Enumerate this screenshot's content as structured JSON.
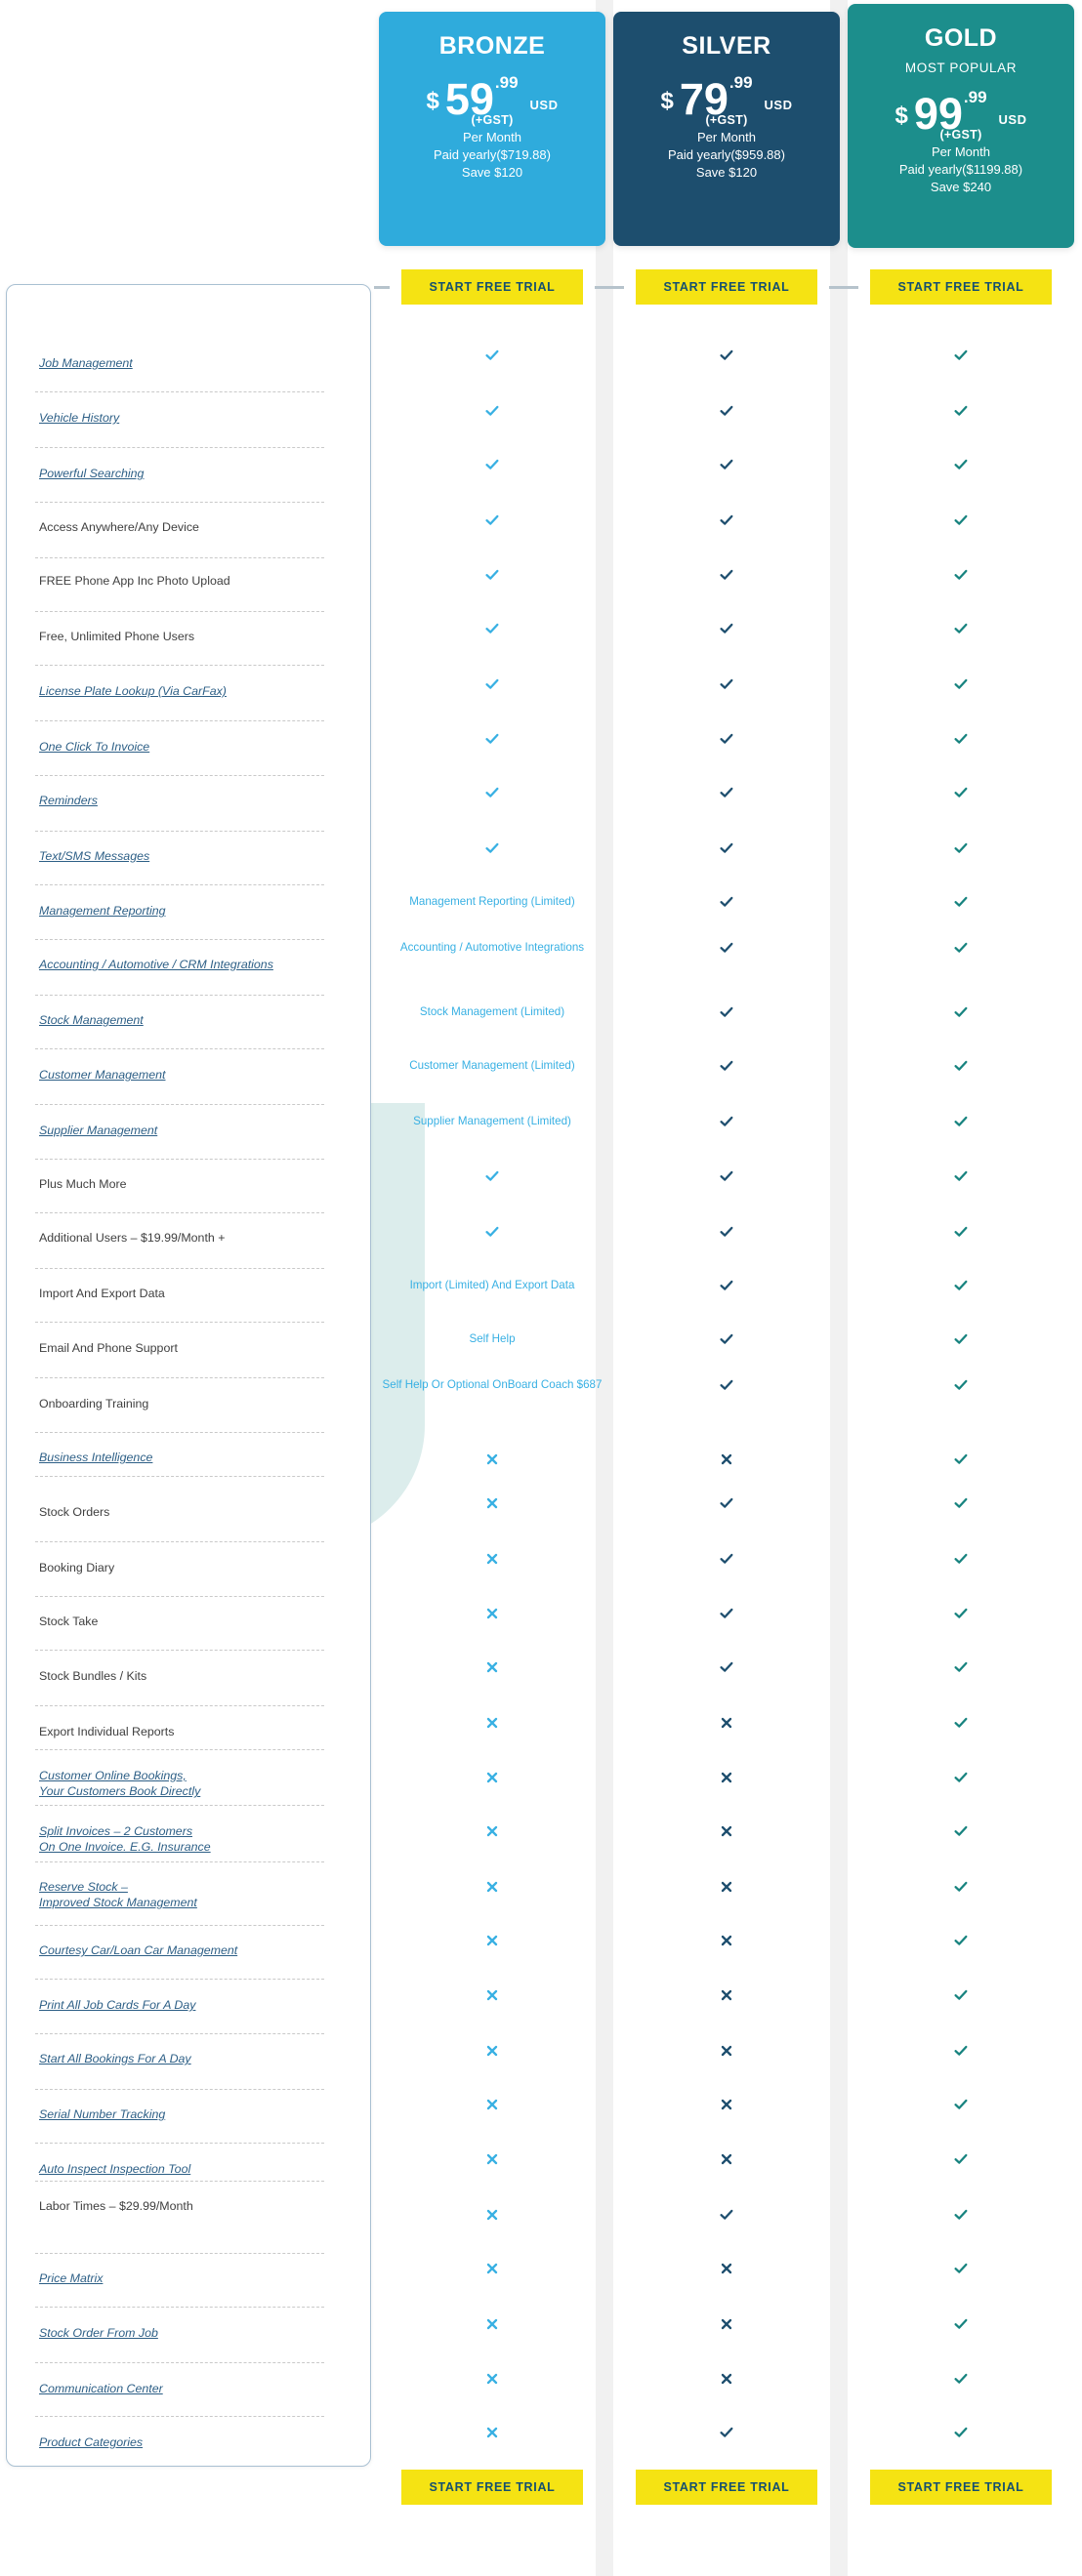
{
  "plans": [
    {
      "key": "bronze",
      "name": "BRONZE",
      "tagline": "",
      "currency": "$",
      "price": "59",
      "cents": ".99",
      "usd": "USD",
      "gst": "(+GST)",
      "period": "Per Month",
      "paid_yearly": "Paid yearly($719.88)",
      "save": "Save $120",
      "cta": "START FREE TRIAL",
      "color": "#2fabdc",
      "mark_color": "#38b0e3"
    },
    {
      "key": "silver",
      "name": "SILVER",
      "tagline": "",
      "currency": "$",
      "price": "79",
      "cents": ".99",
      "usd": "USD",
      "gst": "(+GST)",
      "period": "Per Month",
      "paid_yearly": "Paid yearly($959.88)",
      "save": "Save $120",
      "cta": "START FREE TRIAL",
      "color": "#1d4e6e",
      "mark_color": "#1d4e6e"
    },
    {
      "key": "gold",
      "name": "GOLD",
      "tagline": "MOST POPULAR",
      "currency": "$",
      "price": "99",
      "cents": ".99",
      "usd": "USD",
      "gst": "(+GST)",
      "period": "Per Month",
      "paid_yearly": "Paid yearly($1199.88)",
      "save": "Save $240",
      "cta": "START FREE TRIAL",
      "color": "#1c8e8c",
      "mark_color": "#17837f"
    }
  ],
  "colors": {
    "accent_yellow": "#f5e313",
    "cta_text": "#15506f",
    "link_blue": "#2d5f86",
    "body_text": "#3f3f3f",
    "panel_border": "#a9c0d2",
    "gap_grey": "#f1f1f1",
    "watermark": "#dcedec"
  },
  "features": [
    {
      "label": "Job Management",
      "link": true,
      "bronze": "check",
      "silver": "check",
      "gold": "check"
    },
    {
      "label": "Vehicle History",
      "link": true,
      "bronze": "check",
      "silver": "check",
      "gold": "check"
    },
    {
      "label": "Powerful Searching",
      "link": true,
      "bronze": "check",
      "silver": "check",
      "gold": "check"
    },
    {
      "label": "Access Anywhere/Any Device",
      "link": false,
      "bronze": "check",
      "silver": "check",
      "gold": "check"
    },
    {
      "label": "FREE Phone App Inc Photo Upload",
      "link": false,
      "bronze": "check",
      "silver": "check",
      "gold": "check"
    },
    {
      "label": "Free, Unlimited Phone Users",
      "link": false,
      "bronze": "check",
      "silver": "check",
      "gold": "check"
    },
    {
      "label": "License Plate Lookup (Via CarFax)",
      "link": true,
      "bronze": "check",
      "silver": "check",
      "gold": "check"
    },
    {
      "label": "One Click To Invoice",
      "link": true,
      "bronze": "check",
      "silver": "check",
      "gold": "check"
    },
    {
      "label": "Reminders",
      "link": true,
      "bronze": "check",
      "silver": "check",
      "gold": "check"
    },
    {
      "label": "Text/SMS Messages",
      "link": true,
      "bronze": "check",
      "silver": "check",
      "gold": "check"
    },
    {
      "label": "Management Reporting",
      "link": true,
      "bronze": "Management Reporting (Limited)",
      "silver": "check",
      "gold": "check"
    },
    {
      "label": "Accounting / Automotive / CRM Integrations",
      "link": true,
      "bronze": "Accounting / Automotive Integrations",
      "silver": "check",
      "gold": "check"
    },
    {
      "label": "Stock Management",
      "link": true,
      "bronze": "Stock Management (Limited)",
      "silver": "check",
      "gold": "check"
    },
    {
      "label": "Customer Management",
      "link": true,
      "bronze": "Customer Management (Limited)",
      "silver": "check",
      "gold": "check"
    },
    {
      "label": "Supplier Management",
      "link": true,
      "bronze": "Supplier Management (Limited)",
      "silver": "check",
      "gold": "check"
    },
    {
      "label": "Plus Much More",
      "link": false,
      "bronze": "check",
      "silver": "check",
      "gold": "check"
    },
    {
      "label": "Additional Users – $19.99/Month +",
      "link": false,
      "bronze": "check",
      "silver": "check",
      "gold": "check"
    },
    {
      "label": "Import And Export Data",
      "link": false,
      "bronze": "Import (Limited) And Export Data",
      "silver": "check",
      "gold": "check"
    },
    {
      "label": "Email And Phone Support",
      "link": false,
      "bronze": "Self Help",
      "silver": "check",
      "gold": "check"
    },
    {
      "label": "Onboarding Training",
      "link": false,
      "bronze": "Self Help Or Optional OnBoard Coach $687",
      "silver": "check",
      "gold": "check"
    },
    {
      "label": "Business Intelligence",
      "link": true,
      "bronze": "cross",
      "silver": "cross",
      "gold": "check"
    },
    {
      "label": "Stock Orders",
      "link": false,
      "bronze": "cross",
      "silver": "check",
      "gold": "check"
    },
    {
      "label": "Booking Diary",
      "link": false,
      "bronze": "cross",
      "silver": "check",
      "gold": "check"
    },
    {
      "label": "Stock Take",
      "link": false,
      "bronze": "cross",
      "silver": "check",
      "gold": "check"
    },
    {
      "label": "Stock Bundles / Kits",
      "link": false,
      "bronze": "cross",
      "silver": "check",
      "gold": "check"
    },
    {
      "label": "Export Individual Reports",
      "link": false,
      "bronze": "cross",
      "silver": "cross",
      "gold": "check"
    },
    {
      "label": "Customer Online Bookings,\nYour Customers Book Directly",
      "link": true,
      "bronze": "cross",
      "silver": "cross",
      "gold": "check"
    },
    {
      "label": "Split Invoices – 2 Customers\nOn One Invoice. E.G. Insurance",
      "link": true,
      "bronze": "cross",
      "silver": "cross",
      "gold": "check"
    },
    {
      "label": "Reserve Stock –\nImproved Stock Management",
      "link": true,
      "bronze": "cross",
      "silver": "cross",
      "gold": "check"
    },
    {
      "label": "Courtesy Car/Loan Car Management",
      "link": true,
      "bronze": "cross",
      "silver": "cross",
      "gold": "check"
    },
    {
      "label": "Print All Job Cards For A Day",
      "link": true,
      "bronze": "cross",
      "silver": "cross",
      "gold": "check"
    },
    {
      "label": "Start All Bookings For A Day",
      "link": true,
      "bronze": "cross",
      "silver": "cross",
      "gold": "check"
    },
    {
      "label": "Serial Number Tracking",
      "link": true,
      "bronze": "cross",
      "silver": "cross",
      "gold": "check"
    },
    {
      "label": "Auto Inspect Inspection Tool",
      "link": true,
      "bronze": "cross",
      "silver": "cross",
      "gold": "check"
    },
    {
      "label": "Labor Times – $29.99/Month",
      "link": false,
      "bronze": "cross",
      "silver": "check",
      "gold": "check"
    },
    {
      "label": "Price Matrix",
      "link": true,
      "bronze": "cross",
      "silver": "cross",
      "gold": "check"
    },
    {
      "label": "Stock Order From Job",
      "link": true,
      "bronze": "cross",
      "silver": "cross",
      "gold": "check"
    },
    {
      "label": "Communication Center",
      "link": true,
      "bronze": "cross",
      "silver": "cross",
      "gold": "check"
    },
    {
      "label": "Product Categories",
      "link": true,
      "bronze": "cross",
      "silver": "check",
      "gold": "check"
    }
  ],
  "icons": {
    "check": "check-icon",
    "cross": "cross-icon"
  }
}
